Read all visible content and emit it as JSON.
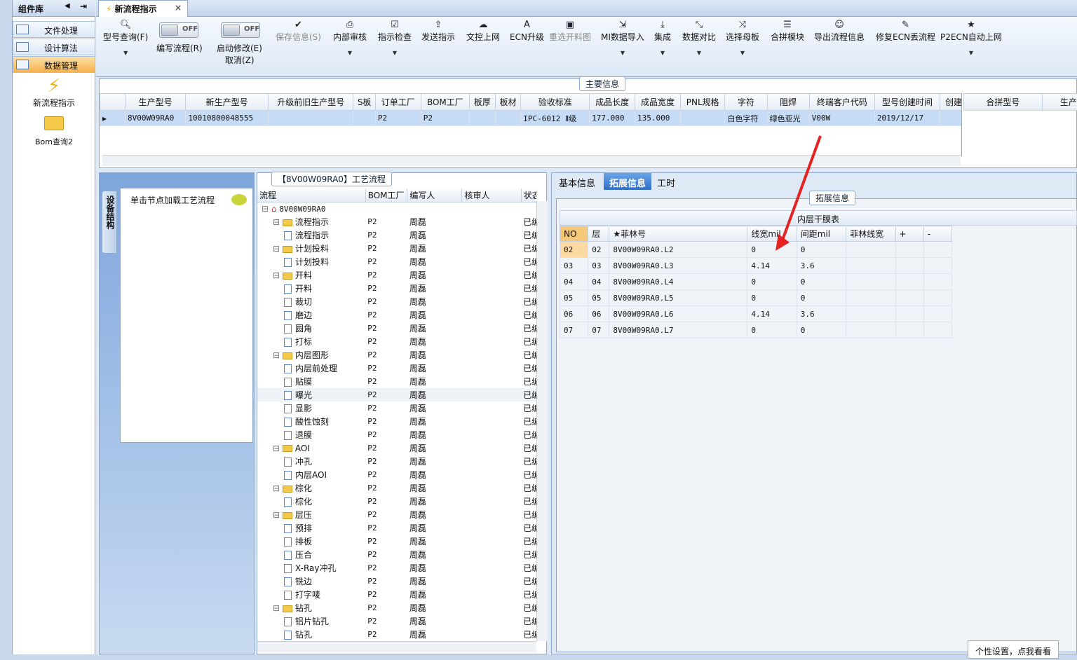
{
  "nav": {
    "title": "组件库",
    "items": [
      {
        "label": "文件处理"
      },
      {
        "label": "设计算法"
      },
      {
        "label": "数据管理"
      }
    ],
    "big": [
      {
        "label": "新流程指示"
      },
      {
        "label": "Bom查询2"
      }
    ]
  },
  "tab": {
    "label": "新流程指示",
    "close": "×"
  },
  "toolbar": {
    "items": [
      {
        "label": "型号查询(F)"
      },
      {
        "label": "编写流程(R)"
      },
      {
        "label": "启动修改(E)"
      },
      {
        "label": "取消(Z)"
      },
      {
        "label": "保存信息(S)"
      },
      {
        "label": "内部审核"
      },
      {
        "label": "指示检查"
      },
      {
        "label": "发送指示"
      },
      {
        "label": "文控上网"
      },
      {
        "label": "ECN升级"
      },
      {
        "label": "重选开料图"
      },
      {
        "label": "MI数据导入"
      },
      {
        "label": "集成"
      },
      {
        "label": "数据对比"
      },
      {
        "label": "选择母板"
      },
      {
        "label": "合拼模块"
      },
      {
        "label": "导出流程信息"
      },
      {
        "label": "修复ECN丢流程"
      },
      {
        "label": "P2ECN自动上网"
      }
    ],
    "toggle_text": "OFF"
  },
  "main": {
    "title": "主要信息",
    "columns": [
      "生产型号",
      "新生产型号",
      "升级前旧生产型号",
      "S板",
      "订单工厂",
      "BOM工厂",
      "板厚",
      "板材",
      "验收标准",
      "成品长度",
      "成品宽度",
      "PNL规格",
      "字符",
      "阻焊",
      "终端客户代码",
      "型号创建时间",
      "创建人"
    ],
    "row": [
      "8V00W09RA0",
      "10010800048555",
      "",
      "",
      "P2",
      "P2",
      "",
      "",
      "IPC-6012 Ⅱ级",
      "177.000",
      "135.000",
      "",
      "白色字符",
      "绿色亚光",
      "V00W",
      "2019/12/17",
      ""
    ],
    "side_columns": [
      "合拼型号",
      "生产型"
    ]
  },
  "left": {
    "vtab": "设备结构",
    "load": "单击节点加载工艺流程"
  },
  "tree": {
    "title": "【8V00W09RA0】工艺流程",
    "columns": [
      "流程",
      "BOM工厂",
      "编写人",
      "核审人",
      "状态"
    ],
    "rows": [
      {
        "name": "8V00W09RA0",
        "lvl": 0,
        "f": "",
        "w": "",
        "s": ""
      },
      {
        "name": "流程指示",
        "lvl": 1,
        "f": "P2",
        "w": "周磊",
        "s": "已编写"
      },
      {
        "name": "流程指示",
        "lvl": 2,
        "f": "P2",
        "w": "周磊",
        "s": "已编写"
      },
      {
        "name": "计划投料",
        "lvl": 1,
        "f": "P2",
        "w": "周磊",
        "s": "已编写"
      },
      {
        "name": "计划投料",
        "lvl": 2,
        "f": "P2",
        "w": "周磊",
        "s": "已编写"
      },
      {
        "name": "开料",
        "lvl": 1,
        "f": "P2",
        "w": "周磊",
        "s": "已编写"
      },
      {
        "name": "开料",
        "lvl": 2,
        "f": "P2",
        "w": "周磊",
        "s": "已编写"
      },
      {
        "name": "裁切",
        "lvl": 2,
        "f": "P2",
        "w": "周磊",
        "s": "已编写"
      },
      {
        "name": "磨边",
        "lvl": 2,
        "f": "P2",
        "w": "周磊",
        "s": "已编写"
      },
      {
        "name": "圆角",
        "lvl": 2,
        "f": "P2",
        "w": "周磊",
        "s": "已编写"
      },
      {
        "name": "打标",
        "lvl": 2,
        "f": "P2",
        "w": "周磊",
        "s": "已编写"
      },
      {
        "name": "内层图形",
        "lvl": 1,
        "f": "P2",
        "w": "周磊",
        "s": "已编写"
      },
      {
        "name": "内层前处理",
        "lvl": 2,
        "f": "P2",
        "w": "周磊",
        "s": "已编写"
      },
      {
        "name": "贴膜",
        "lvl": 2,
        "f": "P2",
        "w": "周磊",
        "s": "已编写"
      },
      {
        "name": "曝光",
        "lvl": 2,
        "f": "P2",
        "w": "周磊",
        "s": "已编写"
      },
      {
        "name": "显影",
        "lvl": 2,
        "f": "P2",
        "w": "周磊",
        "s": "已编写"
      },
      {
        "name": "酸性蚀刻",
        "lvl": 2,
        "f": "P2",
        "w": "周磊",
        "s": "已编写"
      },
      {
        "name": "退膜",
        "lvl": 2,
        "f": "P2",
        "w": "周磊",
        "s": "已编写"
      },
      {
        "name": "AOI",
        "lvl": 1,
        "f": "P2",
        "w": "周磊",
        "s": "已编写"
      },
      {
        "name": "冲孔",
        "lvl": 2,
        "f": "P2",
        "w": "周磊",
        "s": "已编写"
      },
      {
        "name": "内层AOI",
        "lvl": 2,
        "f": "P2",
        "w": "周磊",
        "s": "已编写"
      },
      {
        "name": "棕化",
        "lvl": 1,
        "f": "P2",
        "w": "周磊",
        "s": "已编写"
      },
      {
        "name": "棕化",
        "lvl": 2,
        "f": "P2",
        "w": "周磊",
        "s": "已编写"
      },
      {
        "name": "层压",
        "lvl": 1,
        "f": "P2",
        "w": "周磊",
        "s": "已编写"
      },
      {
        "name": "预排",
        "lvl": 2,
        "f": "P2",
        "w": "周磊",
        "s": "已编写"
      },
      {
        "name": "排板",
        "lvl": 2,
        "f": "P2",
        "w": "周磊",
        "s": "已编写"
      },
      {
        "name": "压合",
        "lvl": 2,
        "f": "P2",
        "w": "周磊",
        "s": "已编写"
      },
      {
        "name": "X-Ray冲孔",
        "lvl": 2,
        "f": "P2",
        "w": "周磊",
        "s": "已编写"
      },
      {
        "name": "铣边",
        "lvl": 2,
        "f": "P2",
        "w": "周磊",
        "s": "已编写"
      },
      {
        "name": "打字唛",
        "lvl": 2,
        "f": "P2",
        "w": "周磊",
        "s": "已编写"
      },
      {
        "name": "钻孔",
        "lvl": 1,
        "f": "P2",
        "w": "周磊",
        "s": "已编写"
      },
      {
        "name": "铝片钻孔",
        "lvl": 2,
        "f": "P2",
        "w": "周磊",
        "s": "已编写"
      },
      {
        "name": "钻孔",
        "lvl": 2,
        "f": "P2",
        "w": "周磊",
        "s": "已编写"
      }
    ]
  },
  "right": {
    "tabs": [
      "基本信息",
      "拓展信息",
      "工时"
    ],
    "section": "拓展信息",
    "table_title": "内层干膜表",
    "columns": [
      "NO",
      "层",
      "★菲林号",
      "线宽mil",
      "间距mil",
      "菲林线宽",
      "+",
      "-"
    ],
    "rows": [
      [
        "02",
        "02",
        "8V00W09RA0.L2",
        "0",
        "0",
        "",
        "",
        ""
      ],
      [
        "03",
        "03",
        "8V00W09RA0.L3",
        "4.14",
        "3.6",
        "",
        "",
        ""
      ],
      [
        "04",
        "04",
        "8V00W09RA0.L4",
        "0",
        "0",
        "",
        "",
        ""
      ],
      [
        "05",
        "05",
        "8V00W09RA0.L5",
        "0",
        "0",
        "",
        "",
        ""
      ],
      [
        "06",
        "06",
        "8V00W09RA0.L6",
        "4.14",
        "3.6",
        "",
        "",
        ""
      ],
      [
        "07",
        "07",
        "8V00W09RA0.L7",
        "0",
        "0",
        "",
        "",
        ""
      ]
    ]
  },
  "tip": "个性设置，点我看看"
}
